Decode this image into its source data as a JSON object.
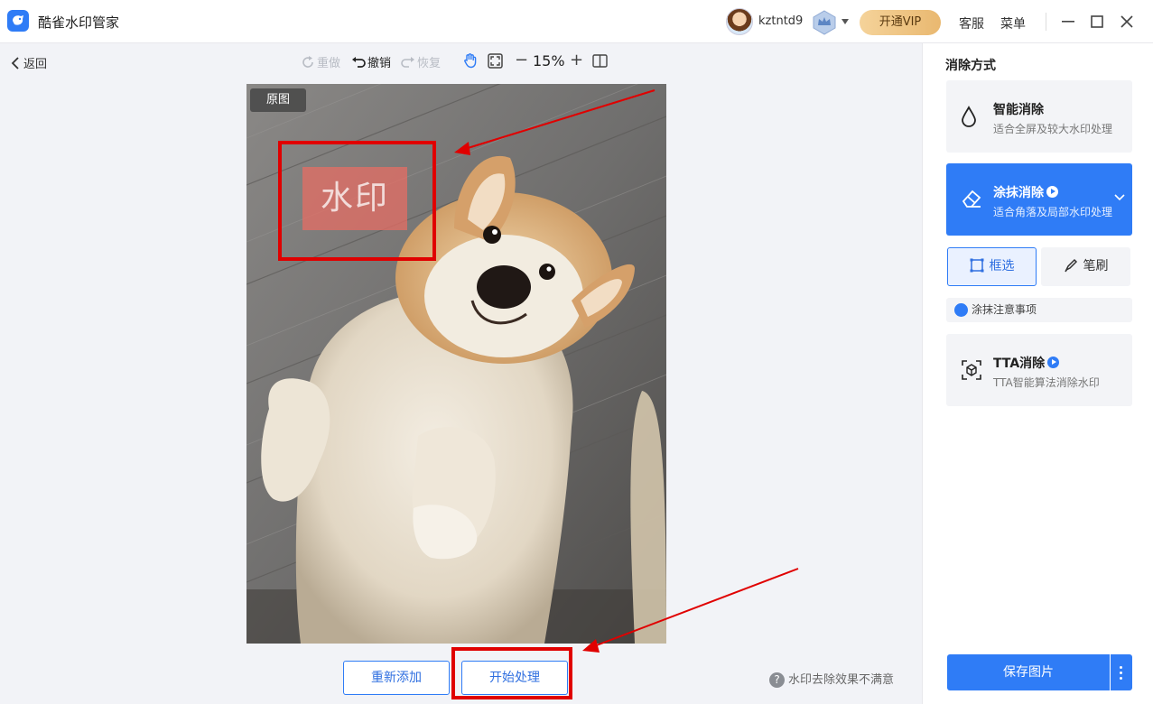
{
  "app": {
    "title": "酷雀水印管家"
  },
  "header": {
    "username": "kztntd9",
    "vip_label": "开通VIP",
    "service_label": "客服",
    "menu_label": "菜单"
  },
  "toolbar": {
    "back_label": "返回",
    "redo_label": "重做",
    "undo_label": "撤销",
    "restore_label": "恢复",
    "zoom_value": "15%",
    "zoom_out": "−",
    "zoom_in": "+"
  },
  "canvas": {
    "original_badge": "原图",
    "watermark_text": "水印"
  },
  "bottom": {
    "re_add_label": "重新添加",
    "start_label": "开始处理",
    "feedback_label": "水印去除效果不满意"
  },
  "right_panel": {
    "title": "消除方式",
    "modes": [
      {
        "title": "智能消除",
        "subtitle": "适合全屏及较大水印处理",
        "selected": false,
        "has_play": false
      },
      {
        "title": "涂抹消除",
        "subtitle": "适合角落及局部水印处理",
        "selected": true,
        "has_play": true
      },
      {
        "title": "TTA消除",
        "subtitle": "TTA智能算法消除水印",
        "selected": false,
        "has_play": true
      }
    ],
    "select_box_label": "框选",
    "brush_label": "笔刷",
    "notice_label": "涂抹注意事项",
    "save_label": "保存图片"
  },
  "colors": {
    "accent": "#2f7cf6",
    "vip_gold": "#e9b870",
    "annotation_red": "#e00000"
  }
}
